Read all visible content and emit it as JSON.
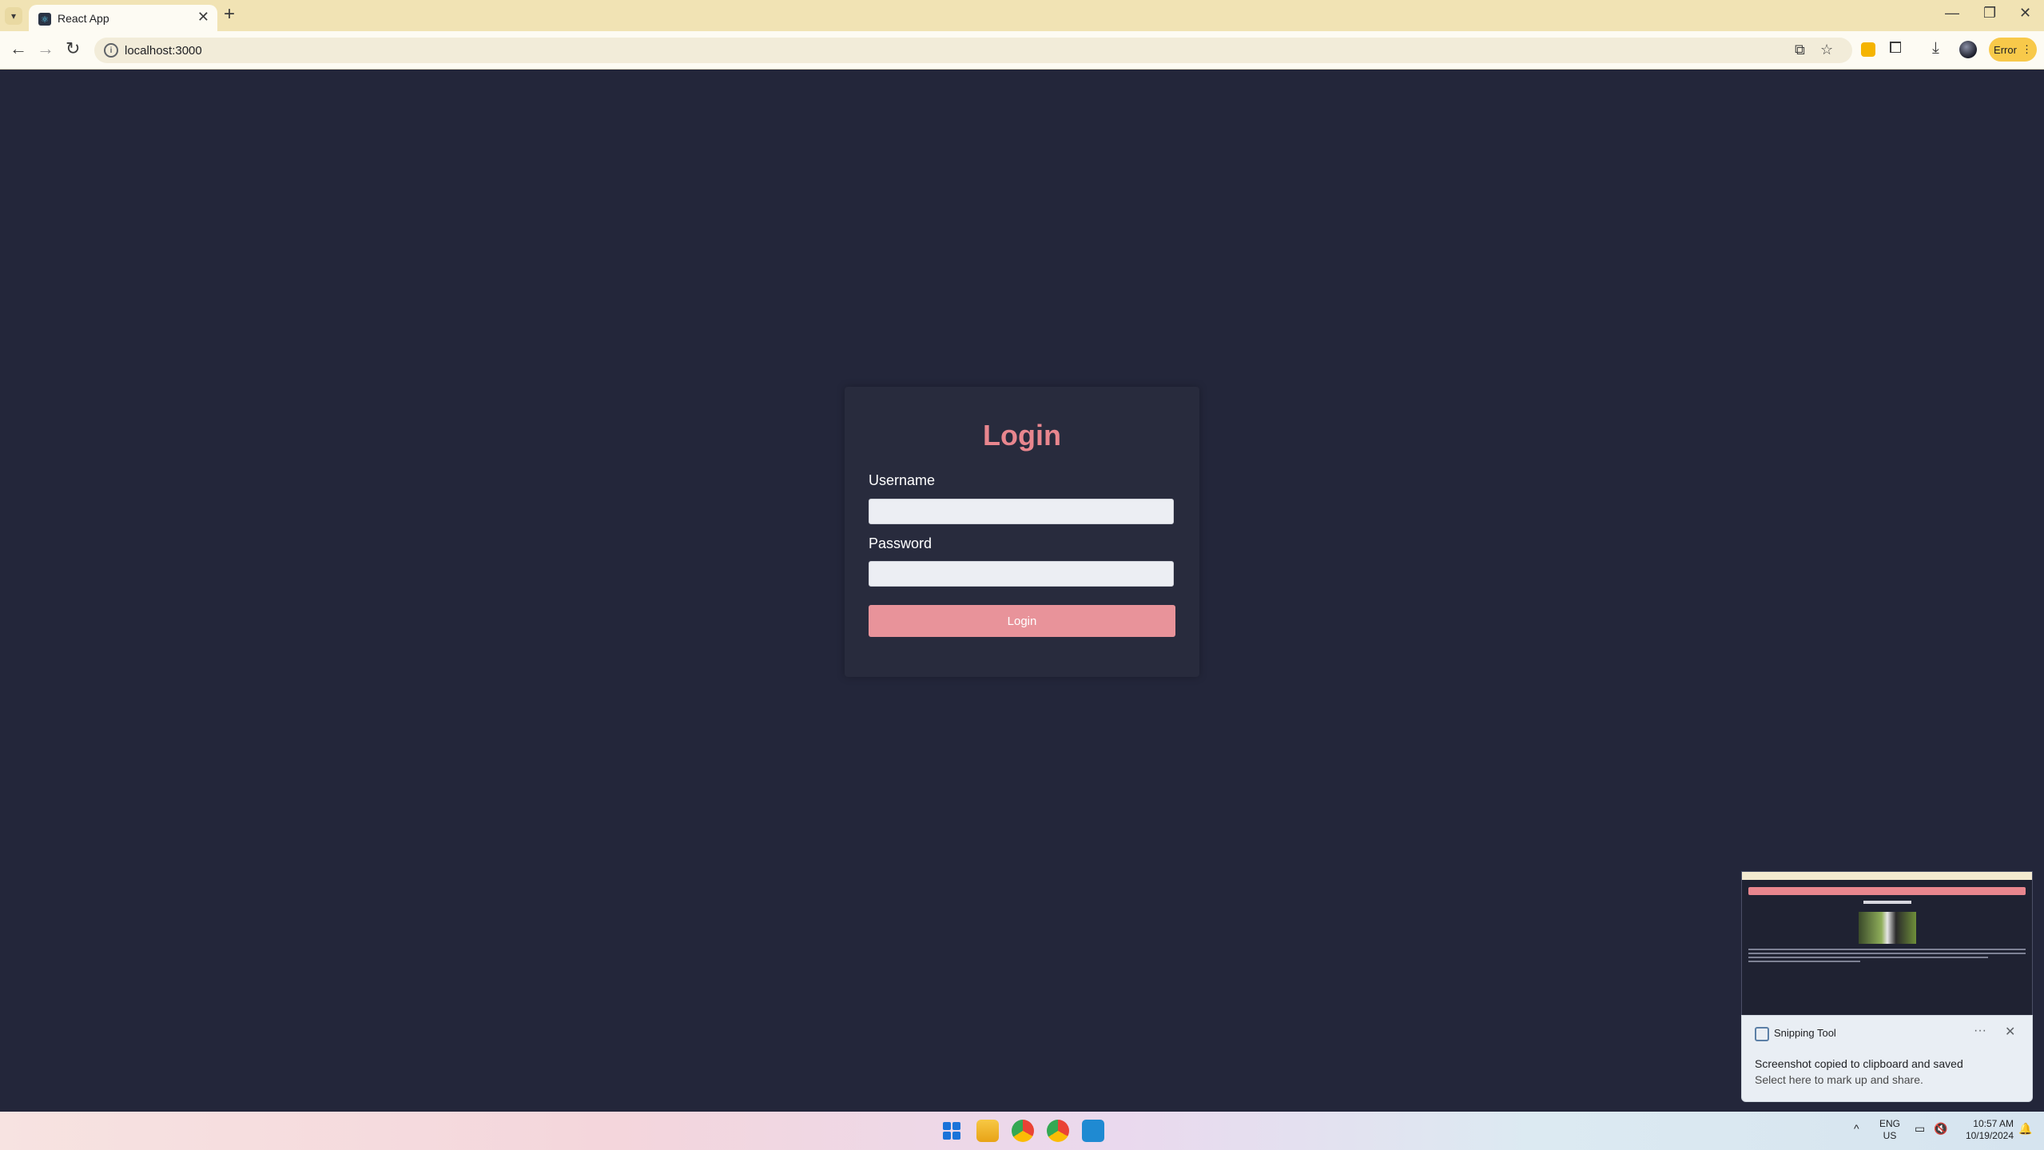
{
  "browser": {
    "tab_title": "React App",
    "new_tab_symbol": "+",
    "tab_close_symbol": "✕",
    "url": "localhost:3000",
    "error_label": "Error",
    "window_controls": {
      "minimize": "—",
      "restore": "❐",
      "close": "✕"
    }
  },
  "login": {
    "title": "Login",
    "username_label": "Username",
    "username_value": "",
    "password_label": "Password",
    "password_value": "",
    "submit_label": "Login",
    "accent_color": "#e8868e"
  },
  "notification": {
    "app_name": "Snipping Tool",
    "message": "Screenshot copied to clipboard and saved",
    "sub_message": "Select here to mark up and share.",
    "more_symbol": "···",
    "close_symbol": "✕"
  },
  "taskbar": {
    "language": "ENG",
    "region": "US",
    "time": "10:57 AM",
    "date": "10/19/2024"
  },
  "icons": [
    "tab-menu-icon",
    "react-favicon",
    "back-icon",
    "forward-icon",
    "reload-icon",
    "site-info-icon",
    "install-icon",
    "star-icon",
    "extension-icon",
    "puzzle-icon",
    "download-icon",
    "avatar",
    "windows-start-icon",
    "file-explorer-icon",
    "chrome-icon",
    "vscode-icon",
    "chevron-up-icon",
    "network-icon",
    "volume-muted-icon",
    "bell-icon"
  ]
}
